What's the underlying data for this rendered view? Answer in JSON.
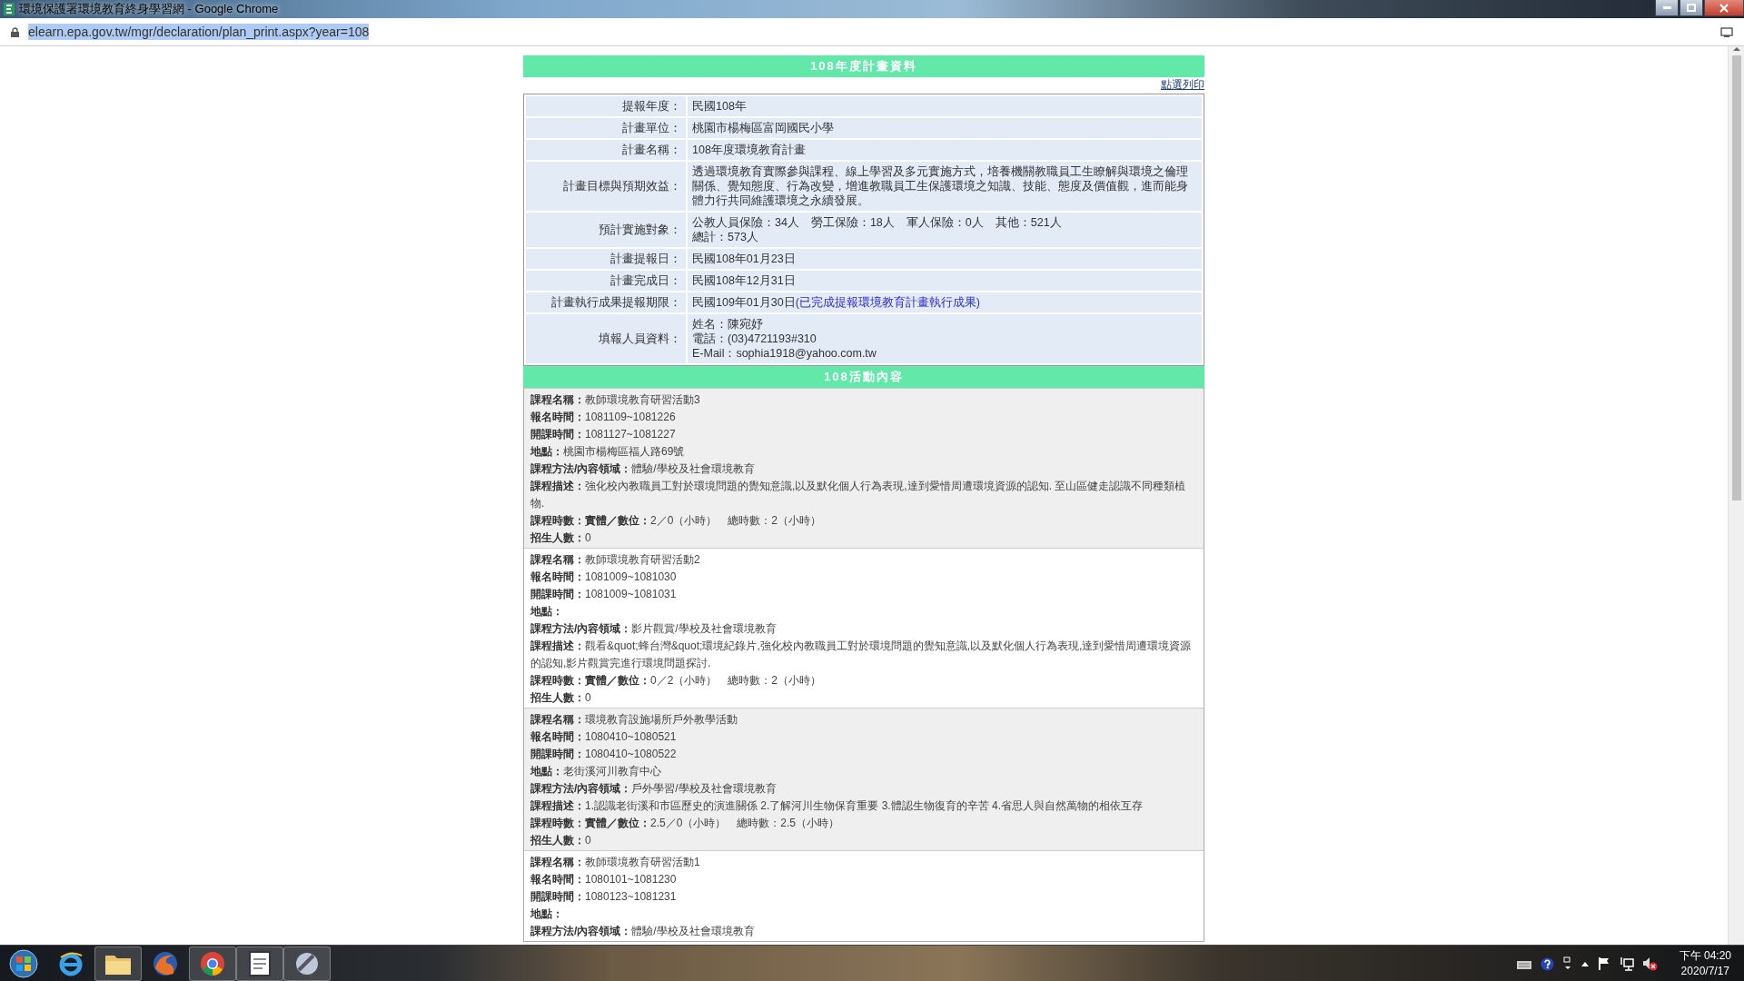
{
  "window": {
    "title": "環境保護署環境教育終身學習網 - Google Chrome"
  },
  "address_bar": {
    "url": "elearn.epa.gov.tw/mgr/declaration/plan_print.aspx?year=108"
  },
  "plan": {
    "heading": "108年度計畫資料",
    "print_link": "點選列印",
    "rows": [
      {
        "label": "提報年度：",
        "lines": [
          "民國108年"
        ]
      },
      {
        "label": "計畫單位：",
        "lines": [
          "桃園市楊梅區富岡國民小學"
        ]
      },
      {
        "label": "計畫名稱：",
        "lines": [
          "108年度環境教育計畫"
        ]
      },
      {
        "label": "計畫目標與預期效益：",
        "lines": [
          "透過環境教育實際參與課程、線上學習及多元實施方式，培養機關教職員工生瞭解與環境之倫理關係、覺知態度、行為改變，增進教職員工生保護環境之知識、技能、態度及價值觀，進而能身體力行共同維護環境之永續發展。"
        ]
      },
      {
        "label": "預計實施對象：",
        "lines": [
          "公教人員保險：34人　勞工保險：18人　軍人保險：0人　其他：521人",
          "總計：573人"
        ]
      },
      {
        "label": "計畫提報日：",
        "lines": [
          "民國108年01月23日"
        ]
      },
      {
        "label": "計畫完成日：",
        "lines": [
          "民國108年12月31日"
        ]
      },
      {
        "label": "計畫執行成果提報期限：",
        "lines": [
          "民國109年01月30日"
        ],
        "link": "(已完成提報環境教育計畫執行成果)"
      },
      {
        "label": "填報人員資料：",
        "lines": [
          "姓名：陳宛妤",
          "電話：(03)4721193#310",
          "E-Mail：sophia1918@yahoo.com.tw"
        ]
      }
    ]
  },
  "activities": {
    "heading": "108活動內容",
    "items": [
      {
        "fields": [
          {
            "label": "課程名稱：",
            "value": "教師環境教育研習活動3"
          },
          {
            "label": "報名時間：",
            "value": "1081109~1081226"
          },
          {
            "label": "開課時間：",
            "value": "1081127~1081227"
          },
          {
            "label": "地點：",
            "value": "桃園市楊梅區福人路69號"
          },
          {
            "label": "課程方法/內容領域：",
            "value": "體驗/學校及社會環境教育"
          },
          {
            "label": "課程描述：",
            "value": "強化校內教職員工對於環境問題的覺知意識,以及默化個人行為表現,達到愛惜周遭環境資源的認知. 至山區健走認識不同種類植物."
          },
          {
            "label": "課程時數：實體／數位：",
            "value": "2／0（小時）　總時數：2（小時）"
          },
          {
            "label": "招生人數：",
            "value": "0"
          }
        ]
      },
      {
        "fields": [
          {
            "label": "課程名稱：",
            "value": "教師環境教育研習活動2"
          },
          {
            "label": "報名時間：",
            "value": "1081009~1081030"
          },
          {
            "label": "開課時間：",
            "value": "1081009~1081031"
          },
          {
            "label": "地點："
          },
          {
            "label": "課程方法/內容領域：",
            "value": "影片觀賞/學校及社會環境教育"
          },
          {
            "label": "課程描述：",
            "value": "觀看&quot;蜂台灣&quot;環境紀錄片,強化校內教職員工對於環境問題的覺知意識,以及默化個人行為表現,達到愛惜周遭環境資源的認知,影片觀賞完進行環境問題探討."
          },
          {
            "label": "課程時數：實體／數位：",
            "value": "0／2（小時）　總時數：2（小時）"
          },
          {
            "label": "招生人數：",
            "value": "0"
          }
        ]
      },
      {
        "fields": [
          {
            "label": "課程名稱：",
            "value": "環境教育設施場所戶外教學活動"
          },
          {
            "label": "報名時間：",
            "value": "1080410~1080521"
          },
          {
            "label": "開課時間：",
            "value": "1080410~1080522"
          },
          {
            "label": "地點：",
            "value": "老街溪河川教育中心"
          },
          {
            "label": "課程方法/內容領域：",
            "value": "戶外學習/學校及社會環境教育"
          },
          {
            "label": "課程描述：",
            "value": "1.認識老街溪和市區歷史的演進關係 2.了解河川生物保育重要 3.體認生物復育的辛苦 4.省思人與自然萬物的相依互存"
          },
          {
            "label": "課程時數：實體／數位：",
            "value": "2.5／0（小時）　總時數：2.5（小時）"
          },
          {
            "label": "招生人數：",
            "value": "0"
          }
        ]
      },
      {
        "fields": [
          {
            "label": "課程名稱：",
            "value": "教師環境教育研習活動1"
          },
          {
            "label": "報名時間：",
            "value": "1080101~1081230"
          },
          {
            "label": "開課時間：",
            "value": "1080123~1081231"
          },
          {
            "label": "地點："
          },
          {
            "label": "課程方法/內容領域：",
            "value": "體驗/學校及社會環境教育"
          }
        ]
      }
    ]
  },
  "taskbar": {
    "clock_time": "下午 04:20",
    "clock_date": "2020/7/17"
  }
}
